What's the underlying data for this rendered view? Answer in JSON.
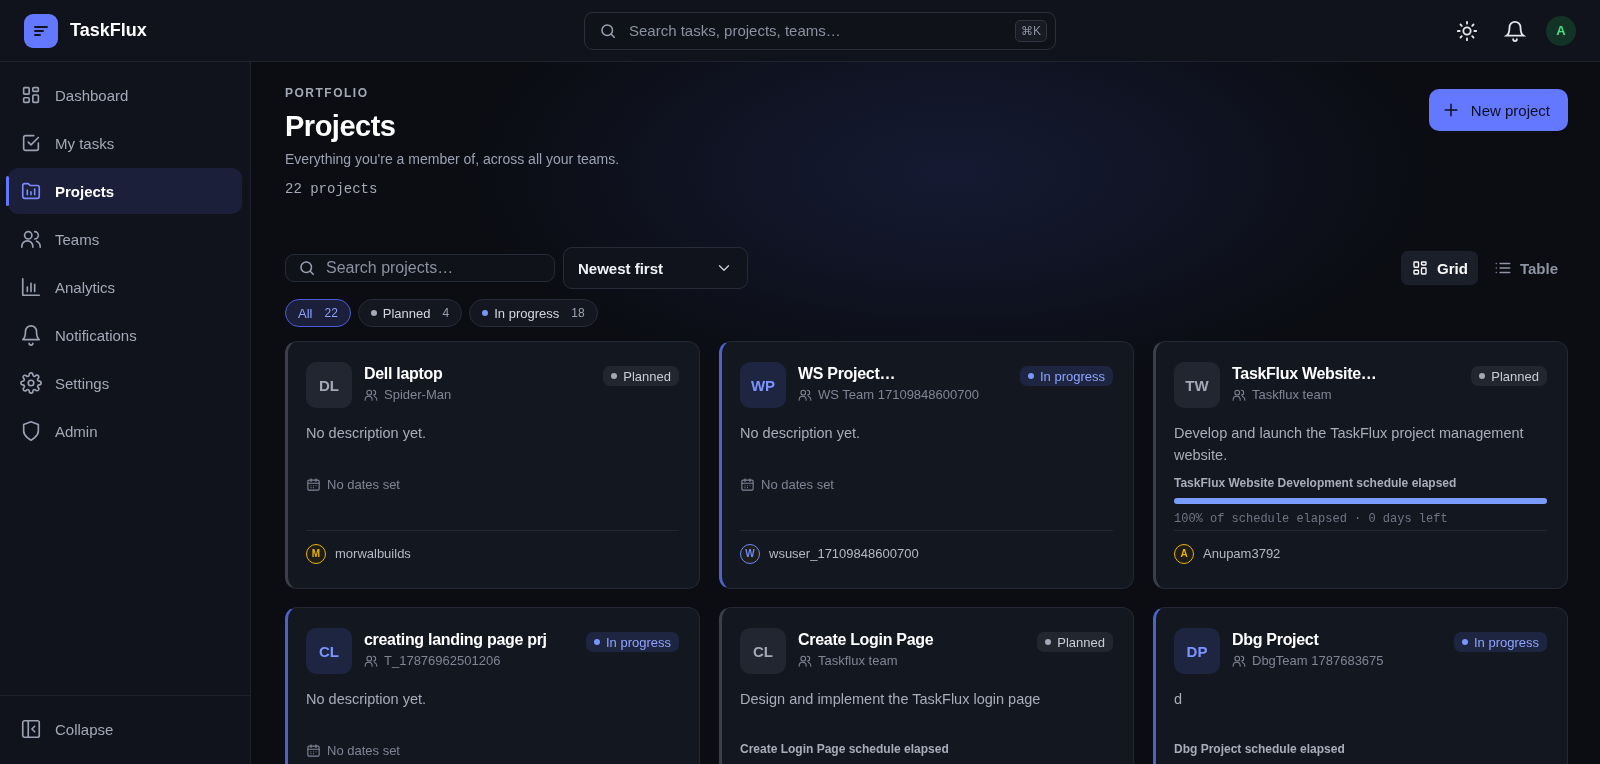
{
  "app": {
    "name": "TaskFlux"
  },
  "search": {
    "placeholder": "Search tasks, projects, teams…",
    "shortcut": "⌘K"
  },
  "user": {
    "initial": "A"
  },
  "sidebar": {
    "items": [
      {
        "label": "Dashboard",
        "selected": false
      },
      {
        "label": "My tasks",
        "selected": false
      },
      {
        "label": "Projects",
        "selected": true
      },
      {
        "label": "Teams",
        "selected": false
      },
      {
        "label": "Analytics",
        "selected": false
      },
      {
        "label": "Notifications",
        "selected": false
      },
      {
        "label": "Settings",
        "selected": false
      },
      {
        "label": "Admin",
        "selected": false
      }
    ],
    "collapse": "Collapse"
  },
  "header": {
    "eyebrow": "PORTFOLIO",
    "title": "Projects",
    "subtitle": "Everything you're a member of, across all your teams.",
    "count": "22 projects",
    "new_button": "New project"
  },
  "filters": {
    "search_placeholder": "Search projects…",
    "sort": "Newest first",
    "views": [
      {
        "label": "Grid",
        "selected": true
      },
      {
        "label": "Table",
        "selected": false
      }
    ],
    "chips": [
      {
        "label": "All",
        "count": "22",
        "kind": "all",
        "selected": true
      },
      {
        "label": "Planned",
        "count": "4",
        "kind": "planned",
        "selected": false
      },
      {
        "label": "In progress",
        "count": "18",
        "kind": "in_progress",
        "selected": false
      }
    ]
  },
  "projects": [
    {
      "initials": "DL",
      "name": "Dell laptop",
      "team": "Spider-Man",
      "status": "Planned",
      "kind": "planned",
      "description": "No description yet.",
      "dates": "No dates set",
      "owner": {
        "initial": "M",
        "name": "morwalbuilds",
        "color": "#eab308"
      }
    },
    {
      "initials": "WP",
      "name": "WS Project…",
      "team": "WS Team 17109848600700",
      "status": "In progress",
      "kind": "in_progress",
      "description": "No description yet.",
      "dates": "No dates set",
      "owner": {
        "initial": "W",
        "name": "wsuser_17109848600700",
        "color": "#6b8afd"
      }
    },
    {
      "initials": "TW",
      "name": "TaskFlux Website…",
      "team": "Taskflux team",
      "status": "Planned",
      "kind": "planned",
      "description": "Develop and launch the TaskFlux project management website.",
      "schedule": {
        "label": "TaskFlux Website Development schedule elapsed",
        "level": 1.0,
        "reading": "100% of schedule elapsed · 0 days left"
      },
      "owner": {
        "initial": "A",
        "name": "Anupam3792",
        "color": "#eab308"
      }
    },
    {
      "initials": "CL",
      "name": "creating landing page prj",
      "team": "T_17876962501206",
      "status": "In progress",
      "kind": "in_progress",
      "description": "No description yet.",
      "dates": "No dates set"
    },
    {
      "initials": "CL",
      "name": "Create Login Page",
      "team": "Taskflux team",
      "status": "Planned",
      "kind": "planned",
      "description": "Design and implement the TaskFlux login page",
      "schedule": {
        "label": "Create Login Page schedule elapsed"
      }
    },
    {
      "initials": "DP",
      "name": "Dbg Project",
      "team": "DbgTeam 1787683675",
      "status": "In progress",
      "kind": "in_progress",
      "description": "d",
      "schedule": {
        "label": "Dbg Project schedule elapsed"
      }
    }
  ]
}
